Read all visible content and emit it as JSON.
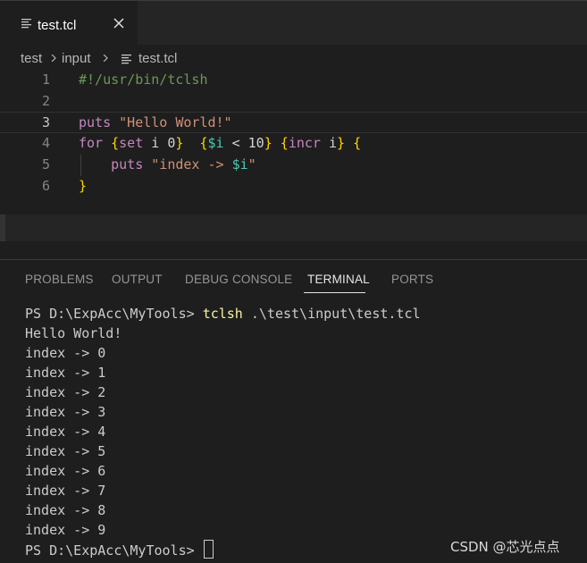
{
  "tab": {
    "label": "test.tcl",
    "file_icon": "file-lines-icon",
    "close_icon": "close-icon"
  },
  "breadcrumb": [
    "test",
    "input",
    "test.tcl"
  ],
  "editor": {
    "line_numbers": [
      "1",
      "2",
      "3",
      "4",
      "5",
      "6"
    ],
    "line1": "#!/usr/bin/tclsh",
    "line3_kw": "puts",
    "line3_str": "\"Hello World!\"",
    "line4_kw": "for",
    "line4_b1": "{",
    "line4_set": "set",
    "line4_i": " i 0",
    "line4_b1c": "}",
    "line4_b2": "{",
    "line4_var": "$i",
    "line4_cmp": " < 10",
    "line4_b2c": "}",
    "line4_b3": "{",
    "line4_incr": "incr",
    "line4_i2": " i",
    "line4_b3c": "}",
    "line4_b4": "{",
    "line5_kw": "puts",
    "line5_str1": "\"index -> ",
    "line5_var": "$i",
    "line5_str2": "\"",
    "line6": "}"
  },
  "panel": {
    "tabs": [
      "PROBLEMS",
      "OUTPUT",
      "DEBUG CONSOLE",
      "TERMINAL",
      "PORTS"
    ],
    "active_tab": "TERMINAL"
  },
  "terminal": {
    "prompt": "PS D:\\ExpAcc\\MyTools> ",
    "cmd": "tclsh",
    "args": " .\\test\\input\\test.tcl",
    "output": [
      "Hello World!",
      "index -> 0",
      "index -> 1",
      "index -> 2",
      "index -> 3",
      "index -> 4",
      "index -> 5",
      "index -> 6",
      "index -> 7",
      "index -> 8",
      "index -> 9"
    ]
  },
  "watermark": "CSDN @芯光点点"
}
